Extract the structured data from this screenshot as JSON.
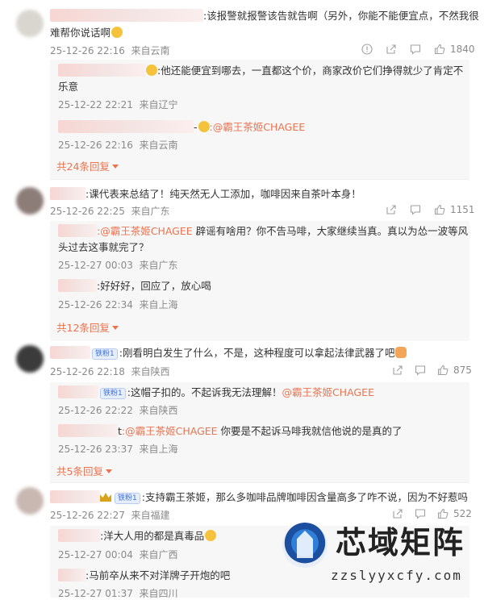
{
  "thread1": {
    "text": ":该报警就报警该告就告啊（另外，你能不能便宜点，不然我很",
    "text_line2": "难帮你说话啊",
    "time": "25-12-26 22:16",
    "location": "来自云南",
    "like_count": "1840",
    "replies": [
      {
        "text": ":他还能便宜到哪去，一直都这个价，商家改价它们挣得就少了肯定不",
        "text_line2": "乐意",
        "time": "25-12-22 22:21",
        "location": "来自辽宁"
      },
      {
        "prefix": "-",
        "mention": ":@霸王茶姬CHAGEE",
        "time": "25-12-26 22:16",
        "location": "来自云南"
      }
    ],
    "more_replies": "共24条回复"
  },
  "thread2": {
    "text": ":课代表来总结了！纯天然无人工添加，咖啡因来自茶叶本身！",
    "time": "25-12-26 22:25",
    "location": "来自广东",
    "like_count": "1151",
    "replies": [
      {
        "mention": ":@霸王茶姬CHAGEE",
        "text": " 辟谣有啥用？你不告马啡，大家继续当真。真以为怂一波等风",
        "text_line2": "头过去这事就完了？",
        "time": "25-12-27 00:03",
        "location": "来自广东"
      },
      {
        "text": ":好好好，回应了，放心喝",
        "time": "25-12-26 22:34",
        "location": "来自上海"
      }
    ],
    "more_replies": "共12条回复"
  },
  "thread3": {
    "badge": "铁粉1",
    "text": ":刚看明白发生了什么，不是，这种程度可以拿起法律武器了吧",
    "time": "25-12-26 22:18",
    "location": "来自陕西",
    "like_count": "875",
    "replies": [
      {
        "badge": "铁粉1",
        "text": ":这帽子扣的。不起诉我无法理解！",
        "mention": "@霸王茶姬CHAGEE",
        "time": "25-12-26 22:22",
        "location": "来自陕西"
      },
      {
        "prefix": "t",
        "mention": ":@霸王茶姬CHAGEE",
        "text": " 你要是不起诉马啡我就信他说的是真的了",
        "time": "25-12-26 23:37",
        "location": "来自上海"
      }
    ],
    "more_replies": "共5条回复"
  },
  "thread4": {
    "badge": "铁粉1",
    "text": ":支持霸王茶姬，那么多咖啡品牌咖啡因含量高多了咋不说，因为不好惹吗",
    "time": "25-12-26 22:27",
    "location": "来自福建",
    "like_count": "522",
    "replies": [
      {
        "text": ":洋大人用的都是真毒品",
        "time": "25-12-27 00:04",
        "location": "来自广西"
      },
      {
        "text": ":马前卒从来不对洋牌子开炮的吧",
        "time": "25-12-27 01:37",
        "location": "来自四川"
      }
    ]
  },
  "watermark": {
    "title": "芯域矩阵",
    "url": "zzslyyxcfy.com"
  },
  "colors": {
    "accent": "#eb7350",
    "meta": "#8a8a8a",
    "reply_bg": "#f7f7f7",
    "badge": "#3d6fd8"
  }
}
